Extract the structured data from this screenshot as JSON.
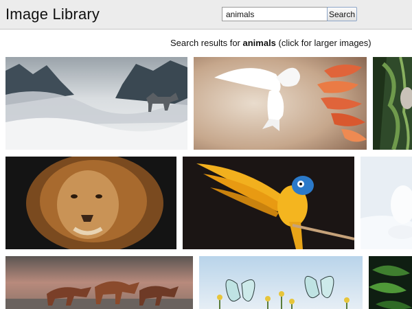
{
  "header": {
    "title": "Image Library",
    "search_value": "animals",
    "search_button_label": "Search"
  },
  "results": {
    "prefix": "Search results for ",
    "query": "animals",
    "suffix": " (click for larger images)"
  },
  "images": [
    {
      "subject": "wolf-in-misty-mountains"
    },
    {
      "subject": "white-dove-autumn-leaves"
    },
    {
      "subject": "forest-pine-branches"
    },
    {
      "subject": "lion-portrait"
    },
    {
      "subject": "macaw-parrot-flying"
    },
    {
      "subject": "arctic-fox-snow"
    },
    {
      "subject": "horses-running-beach"
    },
    {
      "subject": "butterflies-flowers"
    },
    {
      "subject": "green-leaves"
    }
  ]
}
